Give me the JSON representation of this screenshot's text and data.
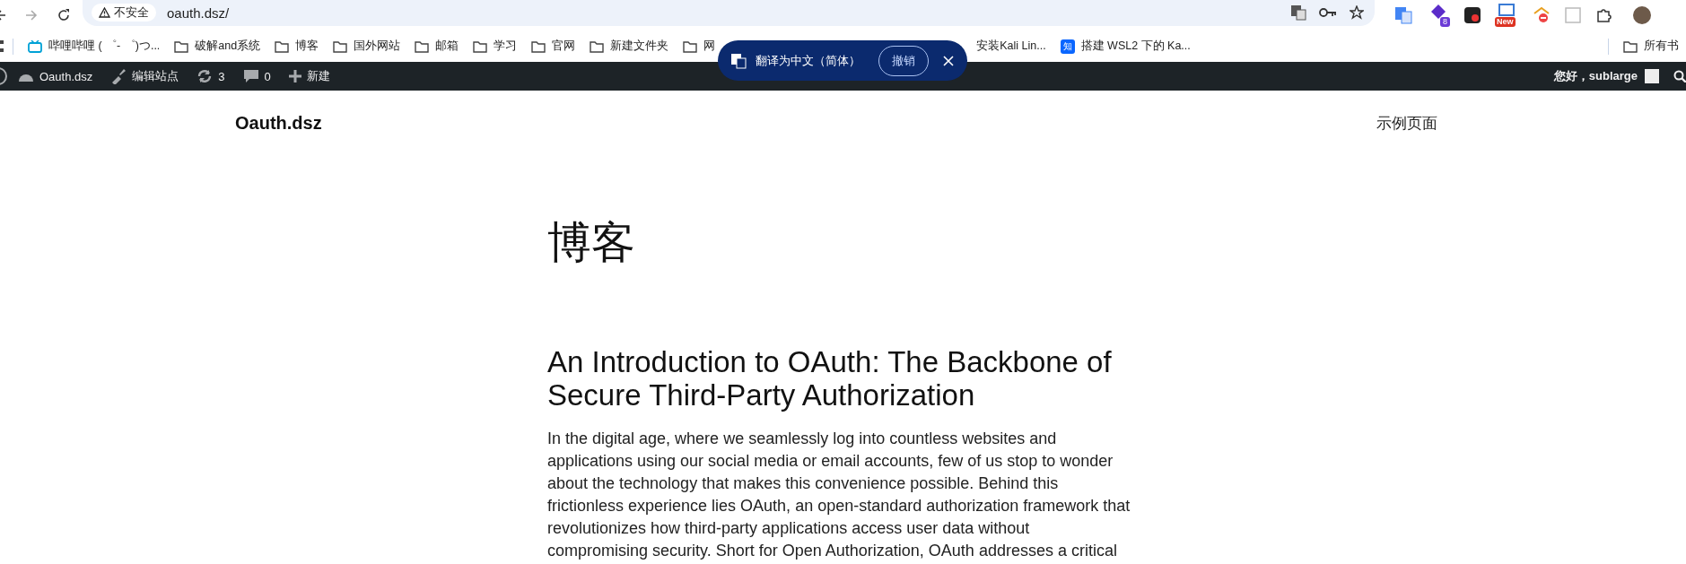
{
  "browser": {
    "insecure_label": "不安全",
    "url": "oauth.dsz/"
  },
  "bookmarks": [
    {
      "kind": "site",
      "label": "哔哩哔哩 ( ゜- ゜)つ..."
    },
    {
      "kind": "folder",
      "label": "破解and系统"
    },
    {
      "kind": "folder",
      "label": "博客"
    },
    {
      "kind": "folder",
      "label": "国外网站"
    },
    {
      "kind": "folder",
      "label": "邮箱"
    },
    {
      "kind": "folder",
      "label": "学习"
    },
    {
      "kind": "folder",
      "label": "官网"
    },
    {
      "kind": "folder",
      "label": "新建文件夹"
    },
    {
      "kind": "folder",
      "label": "网"
    },
    {
      "kind": "plain",
      "label": "安装Kali Lin..."
    },
    {
      "kind": "zhihu",
      "badge": "知",
      "label": "搭建 WSL2 下的 Ka..."
    }
  ],
  "all_bookmarks": "所有书",
  "extensions": [
    {
      "kind": "translate"
    },
    {
      "kind": "count",
      "badge": "8"
    },
    {
      "kind": "dark"
    },
    {
      "kind": "new",
      "badge": "New"
    },
    {
      "kind": "blocked"
    },
    {
      "kind": "ip"
    },
    {
      "kind": "puzzle"
    }
  ],
  "admin_bar": {
    "items": [
      {
        "kind": "site",
        "label": "Oauth.dsz"
      },
      {
        "kind": "edit",
        "label": "编辑站点"
      },
      {
        "kind": "updates",
        "label": "3"
      },
      {
        "kind": "comments",
        "label": "0"
      },
      {
        "kind": "new",
        "label": "新建"
      }
    ],
    "greeting": "您好，sublarge"
  },
  "translate_popup": {
    "text": "翻译为中文（简体）",
    "button": "撤销"
  },
  "site": {
    "title": "Oauth.dsz",
    "nav": [
      "示例页面"
    ]
  },
  "page_title": "博客",
  "post": {
    "title": "An Introduction to OAuth: The Backbone of Secure Third-Party Authorization",
    "excerpt": "In the digital age, where we seamlessly log into countless websites and applications using our social media or email accounts, few of us stop to wonder about the technology that makes this convenience possible. Behind this frictionless experience lies OAuth, an open-standard authorization framework that revolutionizes how third-party applications access user data without compromising security. Short for Open Authorization, OAuth addresses a critical"
  }
}
